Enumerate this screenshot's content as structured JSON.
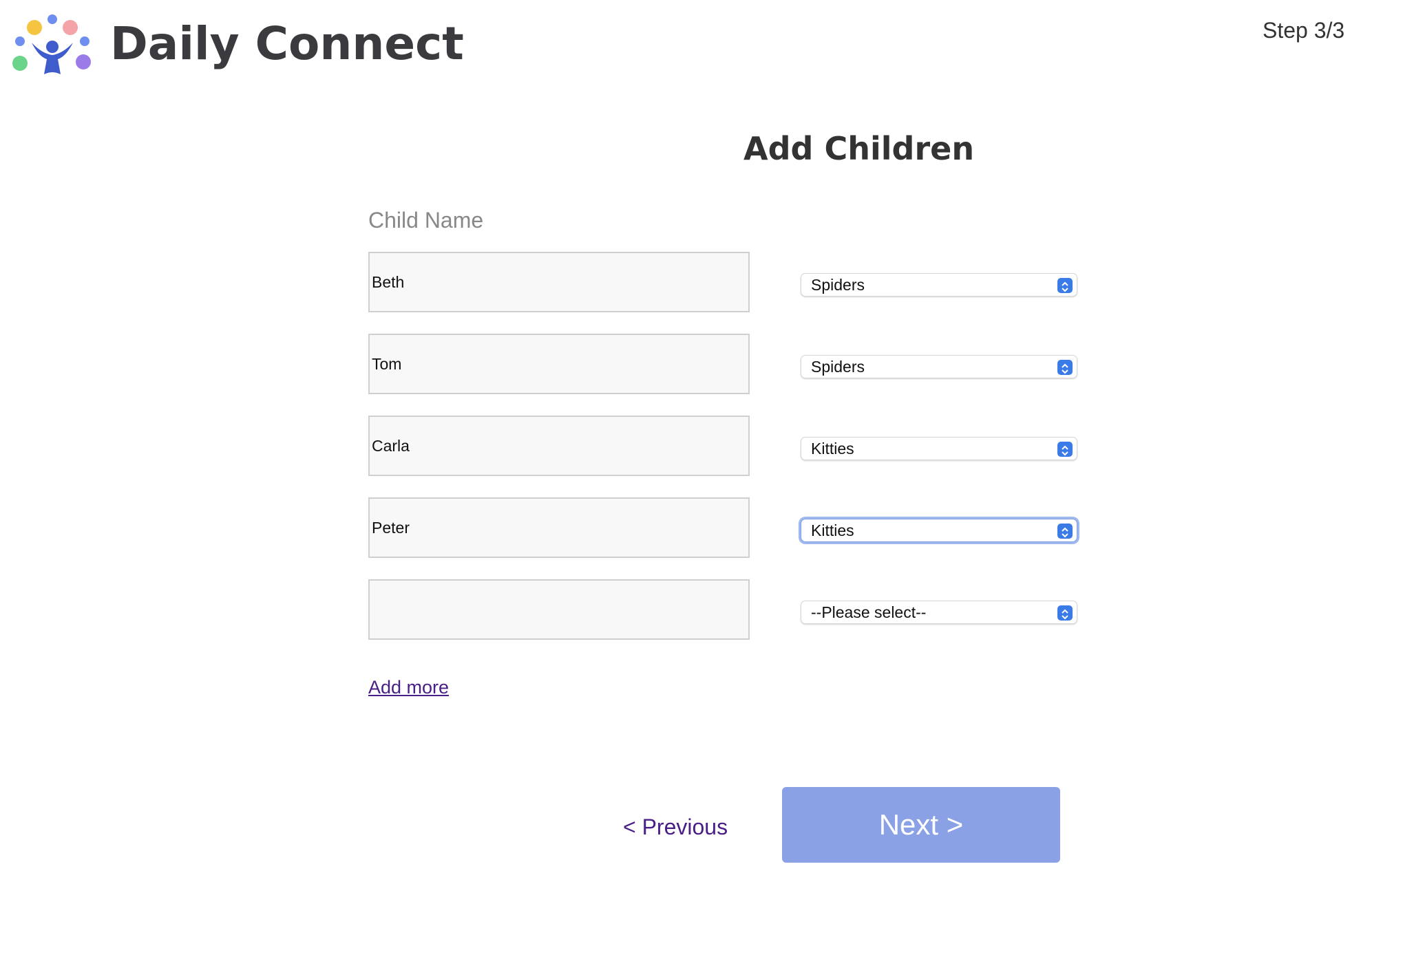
{
  "header": {
    "brand_name": "Daily Connect",
    "step_label": "Step 3/3",
    "logo_colors": {
      "yellow": "#f5c542",
      "pink": "#f4a3a8",
      "blue": "#6f8ff0",
      "green": "#6cd48a",
      "purple": "#9b7be8",
      "figure": "#3f5ccc"
    }
  },
  "page": {
    "title": "Add Children",
    "column_label": "Child Name"
  },
  "children": [
    {
      "name": "Beth",
      "group": "Spiders",
      "focused": false
    },
    {
      "name": "Tom",
      "group": "Spiders",
      "focused": false
    },
    {
      "name": "Carla",
      "group": "Kitties",
      "focused": false
    },
    {
      "name": "Peter",
      "group": "Kitties",
      "focused": true
    },
    {
      "name": "",
      "group": "--Please select--",
      "focused": false
    }
  ],
  "actions": {
    "add_more": "Add more",
    "previous": "< Previous",
    "next": "Next >"
  },
  "colors": {
    "accent_link": "#4a1e87",
    "next_button": "#8aa1e6",
    "select_chevron": "#3b7be8"
  }
}
